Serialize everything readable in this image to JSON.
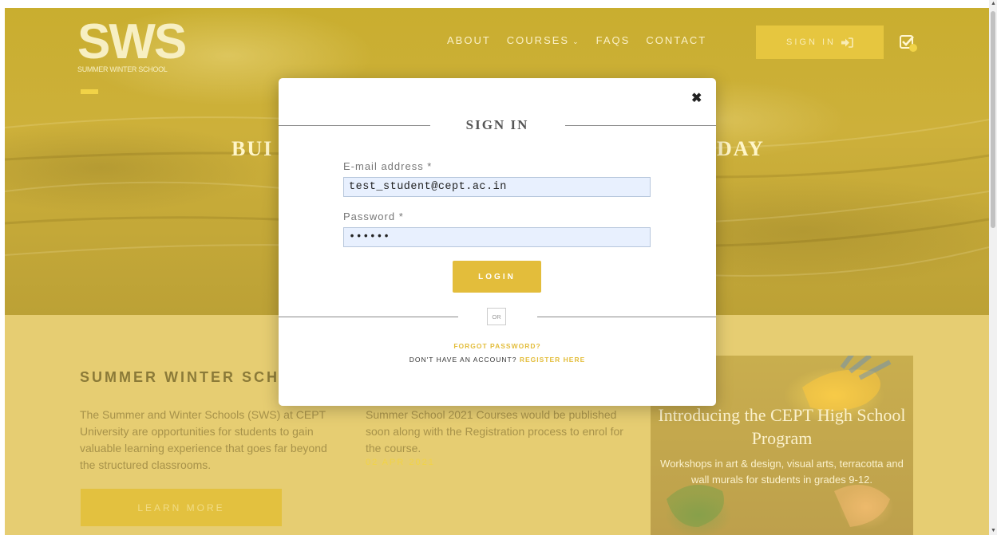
{
  "header": {
    "logo_main": "SWS",
    "logo_sub": "SUMMER WINTER SCHOOL",
    "nav": {
      "about": "ABOUT",
      "courses": "COURSES",
      "faqs": "FAQS",
      "contact": "CONTACT"
    },
    "sign_in_label": "SIGN IN",
    "icons": {
      "courses_dropdown": "chevron-down-icon",
      "sign_in": "sign-in-arrow-icon",
      "tasks": "checkbox-icon"
    }
  },
  "hero": {
    "headline_left": "BUI",
    "headline_right": "DAY"
  },
  "about": {
    "title": "SUMMER WINTER SCH",
    "description": "The Summer and Winter Schools (SWS) at CEPT University are opportunities for students to gain valuable learning experience that goes far beyond the structured classrooms.",
    "learn_more": "LEARN MORE"
  },
  "news": {
    "text": "Summer School 2021 Courses would be published soon along with the Registration process to enrol for the course.",
    "date": "02 APR 2021"
  },
  "promo": {
    "title": "Introducing the CEPT High School Program",
    "description": "Workshops in art & design, visual arts, terracotta and wall murals for students in grades 9-12."
  },
  "modal": {
    "close_symbol": "✖",
    "title": "SIGN IN",
    "email_label": "E-mail address *",
    "email_value": "test_student@cept.ac.in",
    "password_label": "Password *",
    "password_value": "••••••",
    "login_label": "LOGIN",
    "or_label": "OR",
    "forgot_label": "FORGOT PASSWORD?",
    "no_account_text": "DON'T HAVE AN ACCOUNT?",
    "register_label": "REGISTER HERE"
  },
  "colors": {
    "accent": "#e3bd3b",
    "hero_overlay": "#c9ae2f",
    "section_bg": "#e6cd72"
  }
}
